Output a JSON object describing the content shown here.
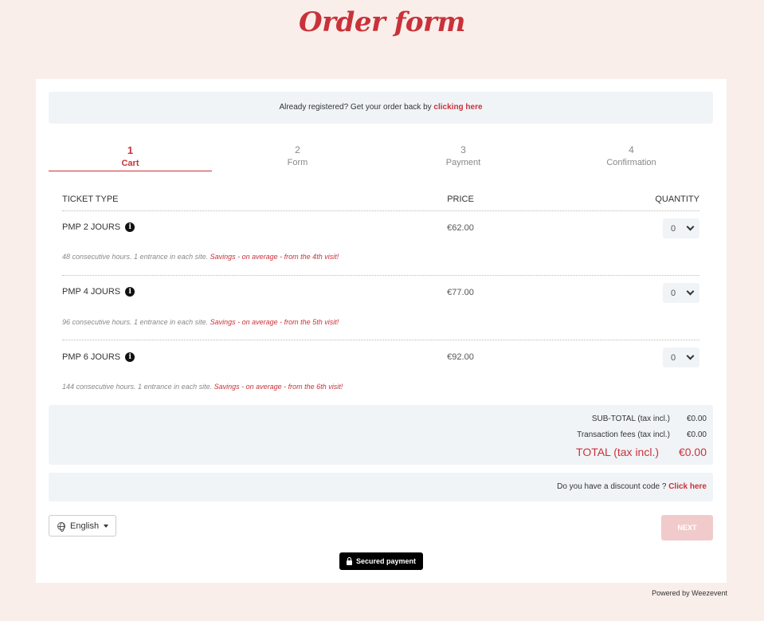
{
  "header": {
    "title": "Order form"
  },
  "banner": {
    "text": "Already registered? Get your order back by ",
    "link": "clicking here"
  },
  "steps": [
    {
      "num": "1",
      "label": "Cart"
    },
    {
      "num": "2",
      "label": "Form"
    },
    {
      "num": "3",
      "label": "Payment"
    },
    {
      "num": "4",
      "label": "Confirmation"
    }
  ],
  "table": {
    "col_type": "TICKET TYPE",
    "col_price": "PRICE",
    "col_qty": "QUANTITY",
    "rows": [
      {
        "name": "PMP 2 JOURS",
        "price": "€62.00",
        "qty": "0",
        "desc": "48 consecutive hours. 1 entrance in each site. ",
        "desc_hl": "Savings - on average - from the 4th visit!"
      },
      {
        "name": "PMP 4 JOURS",
        "price": "€77.00",
        "qty": "0",
        "desc": "96 consecutive hours. 1 entrance in each site. ",
        "desc_hl": "Savings - on average - from the 5th visit!"
      },
      {
        "name": "PMP 6 JOURS",
        "price": "€92.00",
        "qty": "0",
        "desc": "144 consecutive hours. 1 entrance in each site. ",
        "desc_hl": "Savings - on average - from the 6th visit!"
      }
    ]
  },
  "totals": {
    "subtotal_label": "SUB-TOTAL (tax incl.)",
    "subtotal_value": "€0.00",
    "fees_label": "Transaction fees (tax incl.)",
    "fees_value": "€0.00",
    "total_label": "TOTAL (tax incl.)",
    "total_value": "€0.00"
  },
  "discount": {
    "text": "Do you have a discount code ? ",
    "link": "Click here"
  },
  "footer": {
    "language": "English",
    "next_label": "NEXT",
    "secured_label": "Secured payment",
    "powered_by": "Powered by Weezevent"
  },
  "colors": {
    "accent": "#c9323a",
    "page_bg": "#f9eeea",
    "panel_bg": "#f0f4f7",
    "next_disabled": "#f1cbcb"
  },
  "icons": {
    "info": "info-circle-icon",
    "select": "chevron-down-icon",
    "language": "globe-icon",
    "secure": "lock-icon"
  }
}
